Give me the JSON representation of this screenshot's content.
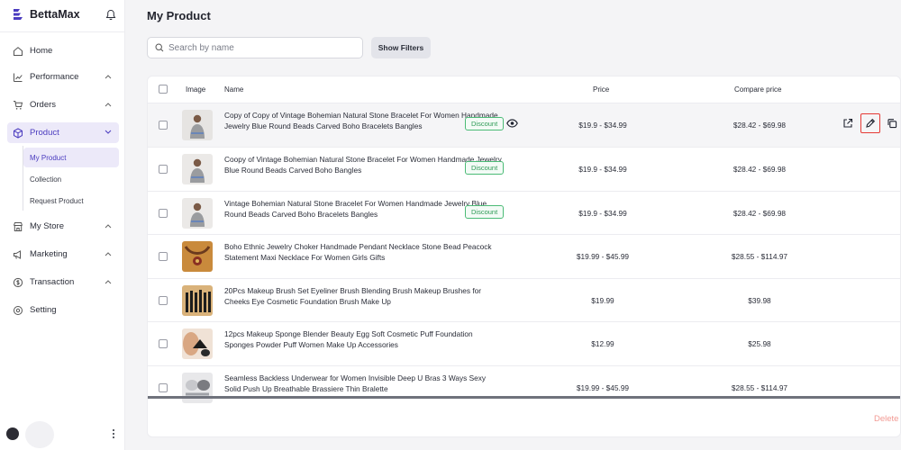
{
  "app": {
    "name": "BettaMax"
  },
  "sidebar": {
    "items": [
      {
        "label": "Home",
        "icon": "home-icon"
      },
      {
        "label": "Performance",
        "icon": "chart-icon"
      },
      {
        "label": "Orders",
        "icon": "cart-icon"
      },
      {
        "label": "Product",
        "icon": "box-icon",
        "active": true
      },
      {
        "label": "My Store",
        "icon": "store-icon"
      },
      {
        "label": "Marketing",
        "icon": "megaphone-icon"
      },
      {
        "label": "Transaction",
        "icon": "dollar-icon"
      },
      {
        "label": "Setting",
        "icon": "gear-icon"
      }
    ],
    "product_sub": [
      {
        "label": "My Product",
        "active": true
      },
      {
        "label": "Collection"
      },
      {
        "label": "Request Product"
      }
    ]
  },
  "main": {
    "title": "My Product",
    "search_placeholder": "Search by name",
    "show_filters": "Show Filters",
    "delete_label": "Delete"
  },
  "table": {
    "columns": {
      "image": "Image",
      "name": "Name",
      "price": "Price",
      "compare": "Compare price"
    },
    "rows": [
      {
        "name": "Copy of Copy of Vintage Bohemian Natural Stone Bracelet For Women Handmade Jewelry Blue Round Beads Carved Boho Bracelets Bangles",
        "badge": "Discount",
        "price": "$19.9 - $34.99",
        "compare": "$28.42 - $69.98"
      },
      {
        "name": "Coopy of Vintage Bohemian Natural Stone Bracelet For Women Handmade Jewelry Blue Round Beads Carved Boho Bangles",
        "badge": "Discount",
        "price": "$19.9 - $34.99",
        "compare": "$28.42 - $69.98"
      },
      {
        "name": "Vintage Bohemian Natural Stone Bracelet For Women Handmade Jewelry Blue Round Beads Carved Boho Bracelets Bangles",
        "badge": "Discount",
        "price": "$19.9 - $34.99",
        "compare": "$28.42 - $69.98"
      },
      {
        "name": "Boho Ethnic Jewelry Choker Handmade Pendant Necklace Stone Bead Peacock Statement Maxi Necklace For Women Girls Gifts",
        "badge": "",
        "price": "$19.99 - $45.99",
        "compare": "$28.55 - $114.97"
      },
      {
        "name": "20Pcs Makeup Brush Set Eyeliner Brush Blending Brush Makeup Brushes for Cheeks Eye Cosmetic Foundation Brush Make Up",
        "badge": "",
        "price": "$19.99",
        "compare": "$39.98"
      },
      {
        "name": "12pcs Makeup Sponge Blender Beauty Egg Soft Cosmetic Puff Foundation Sponges Powder Puff Women Make Up Accessories",
        "badge": "",
        "price": "$12.99",
        "compare": "$25.98"
      },
      {
        "name": "Seamless Backless Underwear for Women Invisible Deep U Bras 3 Ways Sexy Solid Push Up Breathable Brassiere Thin Bralette",
        "badge": "",
        "price": "$19.99 - $45.99",
        "compare": "$28.55 - $114.97"
      }
    ]
  },
  "colors": {
    "accent": "#4a3bbf",
    "badge": "#2e9a56",
    "highlight": "#e53935",
    "delete": "#f29a93"
  }
}
